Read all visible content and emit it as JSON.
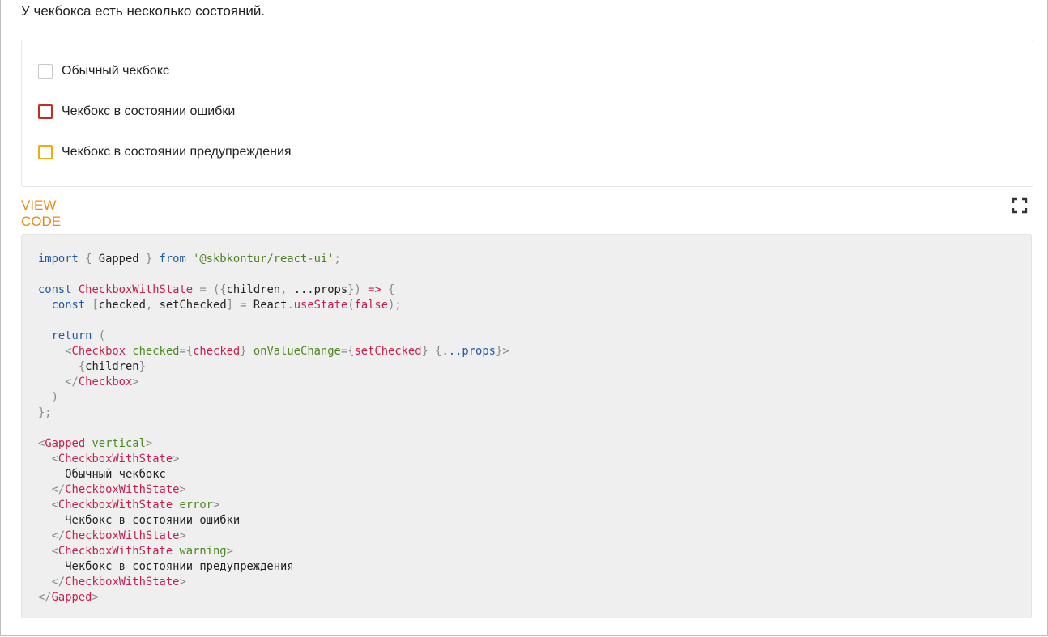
{
  "intro_text": "У чекбокса есть несколько состояний.",
  "preview": {
    "checkboxes": [
      {
        "label": "Обычный чекбокс",
        "state": "normal",
        "checked": false
      },
      {
        "label": "Чекбокс в состоянии ошибки",
        "state": "error",
        "checked": false
      },
      {
        "label": "Чекбокс в состоянии предупреждения",
        "state": "warning",
        "checked": false
      }
    ]
  },
  "view_code_label": "VIEW CODE",
  "icons": {
    "expand": "fullscreen-icon"
  },
  "colors": {
    "accent": "#e88a16",
    "error": "#c42d1d",
    "warning": "#f2a916",
    "code_background": "#efefef"
  },
  "code_lines": [
    [
      {
        "t": "import",
        "c": "kw"
      },
      {
        "t": " { ",
        "c": "pn"
      },
      {
        "t": "Gapped",
        "c": ""
      },
      {
        "t": " } ",
        "c": "pn"
      },
      {
        "t": "from",
        "c": "kw"
      },
      {
        "t": " ",
        "c": ""
      },
      {
        "t": "'@skbkontur/react-ui'",
        "c": "str"
      },
      {
        "t": ";",
        "c": "pn"
      }
    ],
    [],
    [
      {
        "t": "const ",
        "c": "kw"
      },
      {
        "t": "CheckboxWithState",
        "c": "fn"
      },
      {
        "t": " = (",
        "c": "pn"
      },
      {
        "t": "{",
        "c": "pn"
      },
      {
        "t": "children",
        "c": ""
      },
      {
        "t": ", ",
        "c": "pn"
      },
      {
        "t": "...props",
        "c": ""
      },
      {
        "t": "}) ",
        "c": "pn"
      },
      {
        "t": "=>",
        "c": "fn"
      },
      {
        "t": " {",
        "c": "pn"
      }
    ],
    [
      {
        "t": "  ",
        "c": ""
      },
      {
        "t": "const",
        "c": "kw"
      },
      {
        "t": " [",
        "c": "pn"
      },
      {
        "t": "checked",
        "c": ""
      },
      {
        "t": ", ",
        "c": "pn"
      },
      {
        "t": "setChecked",
        "c": ""
      },
      {
        "t": "] = ",
        "c": "pn"
      },
      {
        "t": "React",
        "c": ""
      },
      {
        "t": ".",
        "c": "pn"
      },
      {
        "t": "useState",
        "c": "fn"
      },
      {
        "t": "(",
        "c": "pn"
      },
      {
        "t": "false",
        "c": "fn"
      },
      {
        "t": ");",
        "c": "pn"
      }
    ],
    [],
    [
      {
        "t": "  ",
        "c": ""
      },
      {
        "t": "return",
        "c": "kw"
      },
      {
        "t": " (",
        "c": "pn"
      }
    ],
    [
      {
        "t": "    <",
        "c": "pn"
      },
      {
        "t": "Checkbox",
        "c": "fn"
      },
      {
        "t": " ",
        "c": ""
      },
      {
        "t": "checked",
        "c": "attr"
      },
      {
        "t": "={",
        "c": "pn"
      },
      {
        "t": "checked",
        "c": "fn"
      },
      {
        "t": "} ",
        "c": "pn"
      },
      {
        "t": "onValueChange",
        "c": "attr"
      },
      {
        "t": "={",
        "c": "pn"
      },
      {
        "t": "setChecked",
        "c": "fn"
      },
      {
        "t": "} {",
        "c": "pn"
      },
      {
        "t": "...props",
        "c": "ref"
      },
      {
        "t": "}>",
        "c": "pn"
      }
    ],
    [
      {
        "t": "      {",
        "c": "pn"
      },
      {
        "t": "children",
        "c": ""
      },
      {
        "t": "}",
        "c": "pn"
      }
    ],
    [
      {
        "t": "    </",
        "c": "pn"
      },
      {
        "t": "Checkbox",
        "c": "fn"
      },
      {
        "t": ">",
        "c": "pn"
      }
    ],
    [
      {
        "t": "  )",
        "c": "pn"
      }
    ],
    [
      {
        "t": "};",
        "c": "pn"
      }
    ],
    [],
    [
      {
        "t": "<",
        "c": "pn"
      },
      {
        "t": "Gapped",
        "c": "fn"
      },
      {
        "t": " ",
        "c": ""
      },
      {
        "t": "vertical",
        "c": "attr"
      },
      {
        "t": ">",
        "c": "pn"
      }
    ],
    [
      {
        "t": "  <",
        "c": "pn"
      },
      {
        "t": "CheckboxWithState",
        "c": "fn"
      },
      {
        "t": ">",
        "c": "pn"
      }
    ],
    [
      {
        "t": "    Обычный чекбокс",
        "c": ""
      }
    ],
    [
      {
        "t": "  </",
        "c": "pn"
      },
      {
        "t": "CheckboxWithState",
        "c": "fn"
      },
      {
        "t": ">",
        "c": "pn"
      }
    ],
    [
      {
        "t": "  <",
        "c": "pn"
      },
      {
        "t": "CheckboxWithState",
        "c": "fn"
      },
      {
        "t": " ",
        "c": ""
      },
      {
        "t": "error",
        "c": "attr"
      },
      {
        "t": ">",
        "c": "pn"
      }
    ],
    [
      {
        "t": "    Чекбокс в состоянии ошибки",
        "c": ""
      }
    ],
    [
      {
        "t": "  </",
        "c": "pn"
      },
      {
        "t": "CheckboxWithState",
        "c": "fn"
      },
      {
        "t": ">",
        "c": "pn"
      }
    ],
    [
      {
        "t": "  <",
        "c": "pn"
      },
      {
        "t": "CheckboxWithState",
        "c": "fn"
      },
      {
        "t": " ",
        "c": ""
      },
      {
        "t": "warning",
        "c": "attr"
      },
      {
        "t": ">",
        "c": "pn"
      }
    ],
    [
      {
        "t": "    Чекбокс в состоянии предупреждения",
        "c": ""
      }
    ],
    [
      {
        "t": "  </",
        "c": "pn"
      },
      {
        "t": "CheckboxWithState",
        "c": "fn"
      },
      {
        "t": ">",
        "c": "pn"
      }
    ],
    [
      {
        "t": "</",
        "c": "pn"
      },
      {
        "t": "Gapped",
        "c": "fn"
      },
      {
        "t": ">",
        "c": "pn"
      }
    ]
  ]
}
